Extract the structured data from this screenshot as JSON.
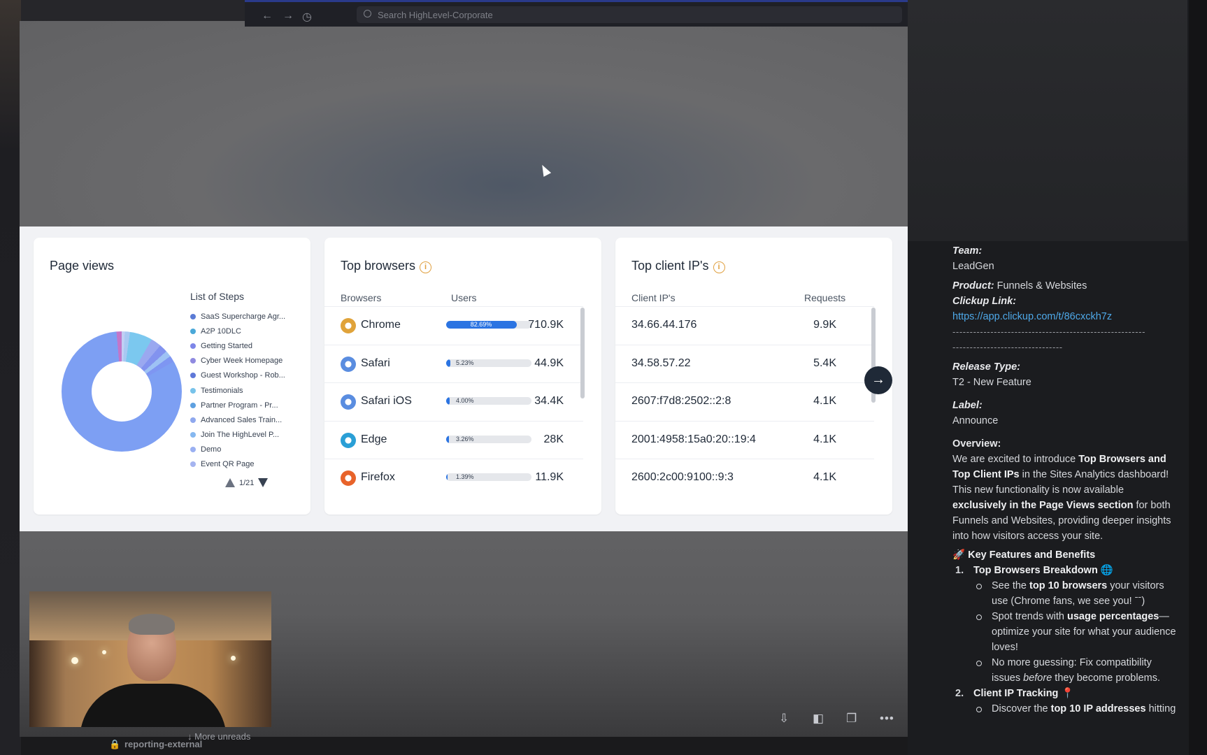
{
  "browser": {
    "search_placeholder": "Search HighLevel-Corporate"
  },
  "page_views": {
    "title": "Page views",
    "legend_title": "List of Steps",
    "steps": [
      {
        "label": "SaaS Supercharge Agr...",
        "color": "#5b7bd5"
      },
      {
        "label": "A2P 10DLC",
        "color": "#4aa8d8"
      },
      {
        "label": "Getting Started",
        "color": "#7d86e8"
      },
      {
        "label": "Cyber Week Homepage",
        "color": "#8f8ae0"
      },
      {
        "label": "Guest Workshop - Rob...",
        "color": "#5f78d8"
      },
      {
        "label": "Testimonials",
        "color": "#78c3ea"
      },
      {
        "label": "Partner Program - Pr...",
        "color": "#5ea0e0"
      },
      {
        "label": "Advanced Sales Train...",
        "color": "#8fa8ee"
      },
      {
        "label": "Join The HighLevel P...",
        "color": "#86b8f0"
      },
      {
        "label": "Demo",
        "color": "#9ab0f2"
      },
      {
        "label": "Event QR Page",
        "color": "#a5b4f0"
      }
    ],
    "pager": "1/21"
  },
  "top_browsers": {
    "title": "Top browsers",
    "col_browser": "Browsers",
    "col_users": "Users",
    "rows": [
      {
        "name": "Chrome",
        "pct": 82.69,
        "pct_label": "82.69%",
        "users": "710.9K",
        "icon": "chrome-icon",
        "color": "#e0a33a"
      },
      {
        "name": "Safari",
        "pct": 5.23,
        "pct_label": "5.23%",
        "users": "44.9K",
        "icon": "safari-icon",
        "color": "#5a8de0"
      },
      {
        "name": "Safari iOS",
        "pct": 4.0,
        "pct_label": "4.00%",
        "users": "34.4K",
        "icon": "safari-ios-icon",
        "color": "#5a8de0"
      },
      {
        "name": "Edge",
        "pct": 3.26,
        "pct_label": "3.26%",
        "users": "28K",
        "icon": "edge-icon",
        "color": "#2a9fd6"
      },
      {
        "name": "Firefox",
        "pct": 1.39,
        "pct_label": "1.39%",
        "users": "11.9K",
        "icon": "firefox-icon",
        "color": "#e8632a"
      }
    ]
  },
  "top_ips": {
    "title": "Top client IP's",
    "col_ip": "Client IP's",
    "col_requests": "Requests",
    "rows": [
      {
        "ip": "34.66.44.176",
        "requests": "9.9K"
      },
      {
        "ip": "34.58.57.22",
        "requests": "5.4K"
      },
      {
        "ip": "2607:f7d8:2502::2:8",
        "requests": "4.1K"
      },
      {
        "ip": "2001:4958:15a0:20::19:4",
        "requests": "4.1K"
      },
      {
        "ip": "2600:2c00:9100::9:3",
        "requests": "4.1K"
      }
    ]
  },
  "bottom": {
    "more_unreads": "More unreads",
    "channel": "reporting-external"
  },
  "release": {
    "team_label": "Team:",
    "team": "LeadGen",
    "product_label": "Product:",
    "product": "Funnels & Websites",
    "clickup_label": "Clickup Link:",
    "clickup_url": "https://app.clickup.com/t/86cxckh7z",
    "divider1": "--------------------------------------------------------",
    "divider2": "--------------------------------",
    "release_type_label": "Release Type:",
    "release_type": "T2 - New Feature",
    "label_label": "Label:",
    "label": "Announce",
    "overview_label": "Overview:",
    "overview_1": "We are excited to introduce ",
    "overview_b1": "Top Browsers and Top Client IPs",
    "overview_2": " in the Sites Analytics dashboard! This new functionality is now available ",
    "overview_b2": "exclusively in the Page Views section",
    "overview_3": " for both Funnels and Websites, providing deeper insights into how visitors access your site.",
    "features_title": "Key Features and Benefits",
    "item1_num": "1.",
    "item1_title": "Top Browsers Breakdown",
    "b1_1": "See the ",
    "b1_1b": "top 10 browsers",
    "b1_1c": " your visitors use (Chrome fans, we see you! ",
    "b1_1d": "ˉˉ)",
    "b1_2": "Spot trends with ",
    "b1_2b": "usage percentages",
    "b1_2c": "—optimize your site for what your audience loves!",
    "b1_3": "No more guessing: Fix compatibility issues ",
    "b1_3i": "before",
    "b1_3c": " they become problems.",
    "item2_num": "2.",
    "item2_title": "Client IP Tracking",
    "b2_1": "Discover the ",
    "b2_1b": "top 10 IP addresses",
    "b2_1c": " hitting your site"
  }
}
